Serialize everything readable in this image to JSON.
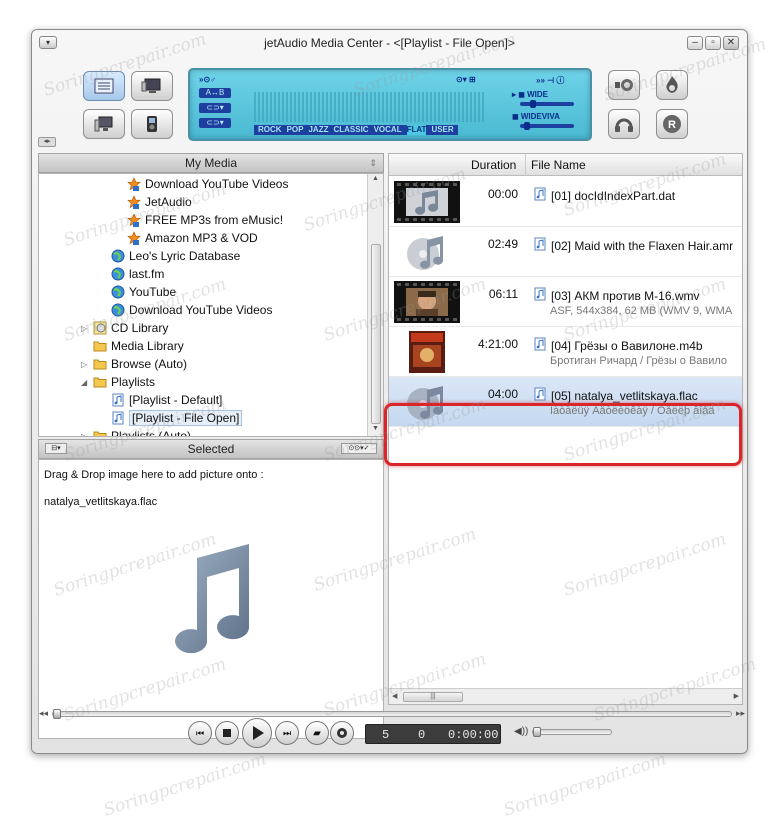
{
  "window": {
    "title": "jetAudio Media Center - <[Playlist - File Open]>",
    "controls": [
      "minimize-icon",
      "restore-icon",
      "close-icon"
    ]
  },
  "lcd": {
    "ab_label": "A↔B",
    "eq_presets": [
      "ROCK",
      "POP",
      "JAZZ",
      "CLASSIC",
      "VOCAL",
      "FLAT",
      "USER"
    ],
    "selected_preset": "FLAT",
    "wide_label": "WIDE",
    "wideviva_label": "WIDEVIVA"
  },
  "left_panel": {
    "header": "My Media",
    "tree": [
      {
        "label": "Download YouTube Videos",
        "icon": "star-icon"
      },
      {
        "label": "JetAudio",
        "icon": "star-icon"
      },
      {
        "label": "FREE MP3s from eMusic!",
        "icon": "star-icon"
      },
      {
        "label": "Amazon MP3 & VOD",
        "icon": "star-icon"
      },
      {
        "label": "Leo's Lyric Database",
        "icon": "globe-icon"
      },
      {
        "label": "last.fm",
        "icon": "globe-icon"
      },
      {
        "label": "YouTube",
        "icon": "globe-icon"
      },
      {
        "label": "Download YouTube Videos",
        "icon": "globe-icon"
      },
      {
        "label": "CD Library",
        "icon": "cd-icon"
      },
      {
        "label": "Media Library",
        "icon": "folder-icon"
      },
      {
        "label": "Browse (Auto)",
        "icon": "folder-icon"
      },
      {
        "label": "Playlists",
        "icon": "folder-icon"
      },
      {
        "label": "[Playlist - Default]",
        "icon": "playlist-icon"
      },
      {
        "label": "[Playlist - File Open]",
        "icon": "playlist-icon"
      },
      {
        "label": "Playlists (Auto)",
        "icon": "folder-icon"
      }
    ],
    "selected_header": "Selected",
    "selected_text1": "Drag & Drop image here to add picture onto :",
    "selected_text2": "natalya_vetlitskaya.flac"
  },
  "playlist": {
    "columns": {
      "duration": "Duration",
      "filename": "File Name"
    },
    "rows": [
      {
        "duration": "00:00",
        "filename": "[01] docIdIndexPart.dat",
        "meta": ""
      },
      {
        "duration": "02:49",
        "filename": "[02] Maid with the Flaxen Hair.amr",
        "meta": ""
      },
      {
        "duration": "06:11",
        "filename": "[03] АКМ против М-16.wmv",
        "meta": "ASF, 544x384, 62 MB (WMV 9, WMA"
      },
      {
        "duration": "4:21:00",
        "filename": "[04] Грёзы о Вавилоне.m4b",
        "meta": "Бротиган Ричард / Грёзы о Вавило"
      },
      {
        "duration": "04:00",
        "filename": "[05] natalya_vetlitskaya.flac",
        "meta": "Íàòàëüÿ Âåòëèöêàÿ / Oåëëþ âîåä"
      }
    ]
  },
  "transport": {
    "track": "5",
    "count": "0",
    "time": "0:00:00"
  },
  "watermark": "Soringpcrepair.com"
}
